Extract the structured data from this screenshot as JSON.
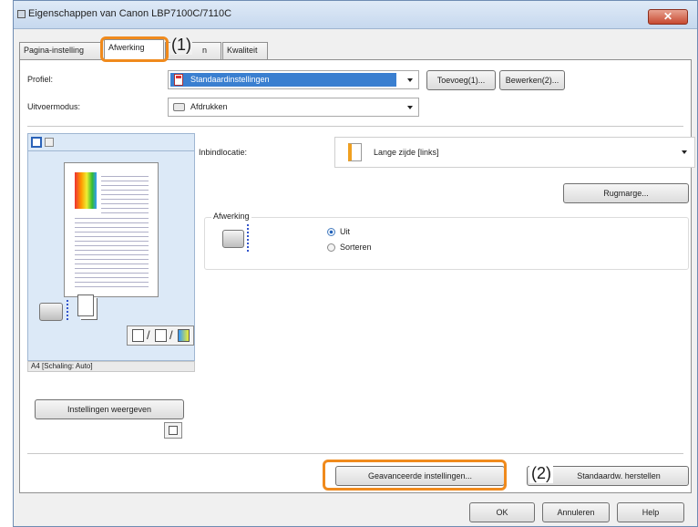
{
  "window": {
    "title": "Eigenschappen van Canon LBP7100C/7110C",
    "close_glyph": "✕"
  },
  "tabs": [
    {
      "label": "Pagina-instelling"
    },
    {
      "label": "Afwerking"
    },
    {
      "label": "Papierbron"
    },
    {
      "label": "Kwaliteit"
    }
  ],
  "profile": {
    "label": "Profiel:",
    "value": "Standaardinstellingen",
    "add_button": "Toevoeg(1)...",
    "edit_button": "Bewerken(2)..."
  },
  "output": {
    "label": "Uitvoermodus:",
    "value": "Afdrukken"
  },
  "preview": {
    "caption": "A4 [Schaling: Auto]",
    "view_settings_button": "Instellingen weergeven",
    "layout_glyphs": "/ / "
  },
  "binding": {
    "label": "Inbindlocatie:",
    "value": "Lange zijde [links]",
    "margin_button": "Rugmarge..."
  },
  "finishing": {
    "group_label": "Afwerking",
    "options": [
      {
        "label": "Uit",
        "selected": true
      },
      {
        "label": "Sorteren",
        "selected": false
      }
    ]
  },
  "bottom": {
    "advanced_button": "Geavanceerde instellingen...",
    "restore_button": "Standaardw. herstellen"
  },
  "dialog_buttons": {
    "ok": "OK",
    "cancel": "Annuleren",
    "help": "Help"
  },
  "callouts": {
    "one": "(1)",
    "two": "(2)"
  },
  "colors": {
    "highlight": "#f08a1c",
    "profile_selection": "#3a7fd0"
  }
}
